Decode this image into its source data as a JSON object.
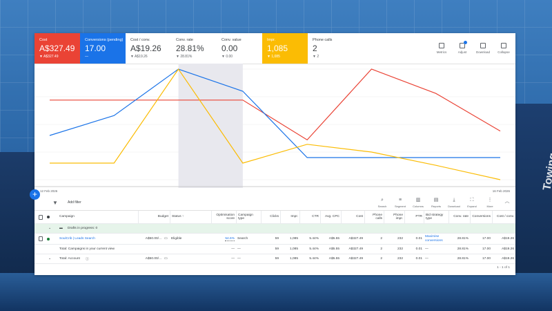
{
  "metrics": [
    {
      "label": "Cost",
      "value": "A$327.49",
      "sub": "▼ A$327.49",
      "style": "red"
    },
    {
      "label": "Conversions (pending)",
      "value": "17.00",
      "sub": "—",
      "style": "blue"
    },
    {
      "label": "Cost / conv.",
      "value": "A$19.26",
      "sub": "▼ A$19.26",
      "style": "plain"
    },
    {
      "label": "Conv. rate",
      "value": "28.81%",
      "sub": "▼ 28.81%",
      "style": "plain"
    },
    {
      "label": "Conv. value",
      "value": "0.00",
      "sub": "▼ 0.00",
      "style": "plain"
    },
    {
      "label": "Impr.",
      "value": "1,085",
      "sub": "▼ 1,085",
      "style": "orange"
    },
    {
      "label": "Phone calls",
      "value": "2",
      "sub": "▼ 2",
      "style": "plain"
    }
  ],
  "metric_actions": [
    {
      "label": "Metrics",
      "icon": "metrics-icon"
    },
    {
      "label": "Adjust",
      "icon": "adjust-icon"
    },
    {
      "label": "Download",
      "icon": "download-icon"
    },
    {
      "label": "Collapse",
      "icon": "collapse-icon"
    }
  ],
  "chart_data": {
    "type": "line",
    "x": [
      "12 Feb 2026",
      "",
      "",
      "",
      "",
      "",
      "",
      "",
      "16 Feb 2026"
    ],
    "x_labels_shown": [
      "12 Feb 2026",
      "16 Feb 2026"
    ],
    "highlight_index": 3,
    "series": [
      {
        "color": "#ea4335",
        "values": [
          0.72,
          0.72,
          0.72,
          0.72,
          0.36,
          1.0,
          0.78,
          0.44
        ]
      },
      {
        "color": "#1a73e8",
        "values": [
          0.4,
          0.58,
          1.0,
          0.8,
          0.2,
          0.2,
          0.2,
          0.2
        ]
      },
      {
        "color": "#fbbc04",
        "values": [
          0.15,
          0.15,
          1.0,
          0.15,
          0.32,
          0.25,
          0.13,
          0.0
        ]
      }
    ],
    "grid": true
  },
  "chart_labels": {
    "start_date": "12 Feb 2026",
    "end_date": "16 Feb 2026"
  },
  "filter": {
    "add_filter": "Add filter"
  },
  "tools": [
    {
      "label": "Search",
      "icon": "search-icon",
      "glyph": "⌕"
    },
    {
      "label": "Segment",
      "icon": "segment-icon",
      "glyph": "≡"
    },
    {
      "label": "Columns",
      "icon": "columns-icon",
      "glyph": "▥"
    },
    {
      "label": "Reports",
      "icon": "reports-icon",
      "glyph": "▤"
    },
    {
      "label": "Download",
      "icon": "download-icon",
      "glyph": "⤓"
    },
    {
      "label": "Expand",
      "icon": "expand-icon",
      "glyph": "⛶"
    },
    {
      "label": "More",
      "icon": "more-icon",
      "glyph": "⋮"
    }
  ],
  "table": {
    "headers": {
      "campaign": "Campaign",
      "budget": "Budget",
      "status": "Status ↑",
      "opt_score": "Optimisation score",
      "campaign_type": "Campaign type",
      "clicks": "Clicks",
      "impr": "Impr.",
      "ctr": "CTR",
      "avg_cpc": "Avg. CPC",
      "cost": "Cost",
      "phone_calls": "Phone calls",
      "phone_impr": "Phone impr.",
      "ptr": "PTR",
      "bid_strategy": "Bid strategy type",
      "conv_rate": "Conv. rate",
      "conversions": "Conversions",
      "cost_conv": "Cost / conv."
    },
    "drafts": "Drafts in progress: 0",
    "campaign_row": {
      "name": "SoulCrib | Leads Search",
      "budget": "A$50.00/...",
      "status": "Eligible",
      "opt_score": "54.6%",
      "campaign_type": "Search",
      "clicks": "59",
      "impr": "1,085",
      "ctr": "5.44%",
      "avg_cpc": "A$5.55",
      "cost": "A$327.49",
      "phone_calls": "2",
      "phone_impr": "232",
      "ptr": "0.01",
      "bid_strategy": "Maximise conversions",
      "conv_rate": "28.81%",
      "conversions": "17.00",
      "cost_conv": "A$19.26"
    },
    "total_view_row": {
      "label": "Total: Campaigns in your current view",
      "opt_score": "—",
      "campaign_type": "—",
      "clicks": "59",
      "impr": "1,085",
      "ctr": "5.44%",
      "avg_cpc": "A$5.55",
      "cost": "A$327.49",
      "phone_calls": "2",
      "phone_impr": "232",
      "ptr": "0.01",
      "bid_strategy": "—",
      "conv_rate": "28.81%",
      "conversions": "17.00",
      "cost_conv": "A$19.26"
    },
    "total_account_row": {
      "label": "Total: Account",
      "budget": "A$50.00/...",
      "opt_score": "—",
      "campaign_type": "—",
      "clicks": "59",
      "impr": "1,085",
      "ctr": "5.44%",
      "avg_cpc": "A$5.55",
      "cost": "A$327.49",
      "phone_calls": "2",
      "phone_impr": "232",
      "ptr": "0.01",
      "bid_strategy": "—",
      "conv_rate": "28.81%",
      "conversions": "17.00",
      "cost_conv": "A$19.26"
    },
    "pagination": "1 - 1 of 1"
  },
  "background": {
    "logo_text": "Towing"
  }
}
